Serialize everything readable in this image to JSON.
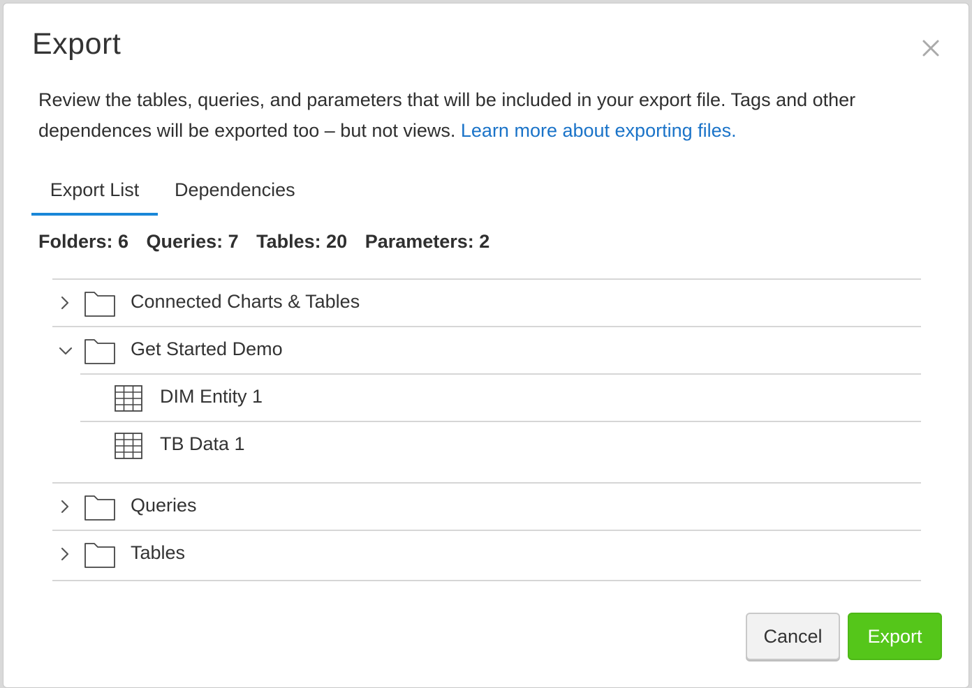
{
  "dialog": {
    "title": "Export",
    "close_icon": "close-icon",
    "description": "Review the tables, queries, and parameters that will be included in your export file. Tags and other dependences will be exported too – but not views. ",
    "learn_more_link": "Learn more about exporting files."
  },
  "tabs": [
    {
      "label": "Export List",
      "active": true
    },
    {
      "label": "Dependencies",
      "active": false
    }
  ],
  "summary": {
    "folders": "Folders: 6",
    "queries": "Queries: 7",
    "tables": "Tables: 20",
    "parameters": "Parameters: 2"
  },
  "tree": {
    "items": [
      {
        "label": "Connected Charts & Tables",
        "type": "folder",
        "expanded": false,
        "icon": "folder-icon"
      },
      {
        "label": "Get Started Demo",
        "type": "folder",
        "expanded": true,
        "icon": "folder-icon",
        "children": [
          {
            "label": "DIM Entity 1",
            "type": "table",
            "icon": "table-grid-icon"
          },
          {
            "label": "TB Data 1",
            "type": "table",
            "icon": "table-grid-icon"
          }
        ]
      },
      {
        "label": "Queries",
        "type": "folder",
        "expanded": false,
        "icon": "folder-icon"
      },
      {
        "label": "Tables",
        "type": "folder",
        "expanded": false,
        "icon": "folder-icon"
      }
    ]
  },
  "buttons": {
    "cancel": "Cancel",
    "export": "Export"
  },
  "colors": {
    "link": "#1a73c8",
    "tab_underline": "#1a87d8",
    "export_button": "#55c61a"
  }
}
